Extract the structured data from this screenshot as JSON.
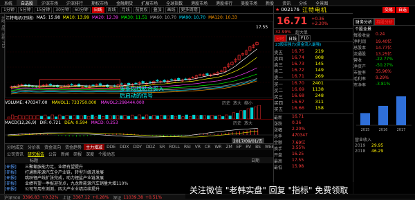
{
  "topmenu": [
    "系统",
    "自选股",
    "沪深市场",
    "沪深排行",
    "期权市场",
    "金融期货",
    "扩展市场",
    "全球指数",
    "港股市场",
    "港股排行",
    "美股市场",
    "新股",
    "资讯",
    "分析",
    "全景图"
  ],
  "toolbar": {
    "periods": [
      "1分钟",
      "5分钟",
      "15分钟",
      "30分钟",
      "60分钟",
      "日线",
      "周线",
      "月线"
    ],
    "active": "日线",
    "options": [
      "前复权",
      "叠加",
      "画线",
      "更多周期"
    ],
    "sel": "更多周期"
  },
  "ma_header": {
    "name": "江特电机(日线)",
    "items": [
      {
        "label": "MA5: 15.98",
        "color": "#ffffff"
      },
      {
        "label": "MA10: 13.99",
        "color": "#ffff00"
      },
      {
        "label": "MA20: 12.39",
        "color": "#ff40ff"
      },
      {
        "label": "MA30: 11.51",
        "color": "#00ff00"
      },
      {
        "label": "MA60: 10.70",
        "color": "#aaaaaa"
      },
      {
        "label": "MA90: 10.70",
        "color": "#00e0ff"
      },
      {
        "label": "MA120: 10.33",
        "color": "#ff9900"
      }
    ]
  },
  "sidebar": [
    "分时",
    "K线",
    "分析",
    "F10"
  ],
  "chart_meta": {
    "price_high": "17.55",
    "annotation_line1": "多条均线粘合买入",
    "annotation_line2": "后启动的信号"
  },
  "vol_header": {
    "label": "VOLUME: 470347.00",
    "ma5": "MAVOL1: 733750.000",
    "ma10": "MAVOL2:298444.000",
    "btns": [
      "历史",
      "放大",
      "缩小"
    ]
  },
  "macd_header": {
    "label": "MACD(12,26,9)",
    "dif": "DIF: 0.721",
    "dea": "DEA: 0.594",
    "macd": "MACD: 0.253",
    "btns": [
      "历史",
      "放大"
    ]
  },
  "bottom_tabs": [
    "分时成交",
    "分价表",
    "资金流向",
    "资金趋势",
    "主力增减",
    "DDE",
    "DDX",
    "DDY",
    "DDZ",
    "SR",
    "ROLL",
    "RSI",
    "VR",
    "CR",
    "WR",
    "ZM",
    "EP",
    "RV",
    "BS",
    "WEB"
  ],
  "bottom_tab_sel": "主力增减",
  "sub_tabs": [
    "公司资讯",
    "研究报告",
    "公告",
    "新闻",
    "研报",
    "深度",
    "个股动态"
  ],
  "sub_tab_sel": "研究报告",
  "news_header": {
    "title": "标题",
    "date": "日期"
  },
  "news": [
    {
      "tag": "[研报]",
      "title": "三聚氰胺能力足，业绩有望提升"
    },
    {
      "tag": "[研报]",
      "title": "打通新能源汽车全产业链，转型升级进发展"
    },
    {
      "tag": "[研报]",
      "title": "跳跃锂产线扩张完成，助力锂盐产业链发展"
    },
    {
      "tag": "[研报]",
      "title": "业绩有望一季报迎拐点，九龙新能源汽车销量大增110%"
    },
    {
      "tag": "[研报]",
      "title": "公司专用车测测，四大产业业绩持续提升"
    }
  ],
  "date_label": "2017/09/01/五",
  "status": {
    "items": [
      "沪深300",
      "上证",
      "深证"
    ],
    "values": [
      "3396.83",
      "3367.12",
      "11039.38"
    ],
    "changes": [
      "+0.32%",
      "+0.28%",
      "+0.51%"
    ]
  },
  "right": {
    "code": "002176",
    "name": "江特电机",
    "buttons": [
      "交易",
      "自选"
    ],
    "price": "16.71",
    "change": "+0.36",
    "pct": "+2.20%",
    "change2": "32.99%",
    "vol_label": "超大单",
    "tabs": [
      "分时",
      "日线",
      "F10"
    ],
    "link": "23股买强力(资金流入最强)",
    "sells": [
      {
        "l": "卖五",
        "p": "16.75",
        "v": "219"
      },
      {
        "l": "卖四",
        "p": "16.74",
        "v": "908"
      },
      {
        "l": "卖三",
        "p": "16.73",
        "v": "145"
      },
      {
        "l": "卖二",
        "p": "16.72",
        "v": "149"
      },
      {
        "l": "卖一",
        "p": "16.71",
        "v": "269"
      }
    ],
    "buys": [
      {
        "l": "买一",
        "p": "16.70",
        "v": "2401"
      },
      {
        "l": "买二",
        "p": "16.69",
        "v": "1138"
      },
      {
        "l": "买三",
        "p": "16.68",
        "v": "248"
      },
      {
        "l": "买四",
        "p": "16.67",
        "v": "311"
      },
      {
        "l": "买五",
        "p": "16.66",
        "v": "158"
      }
    ],
    "stats": [
      {
        "k": "最新",
        "v": "16.71"
      },
      {
        "k": "涨跌",
        "v": "0.36"
      },
      {
        "k": "涨幅",
        "v": "2.20%"
      },
      {
        "k": "总手",
        "v": "470347"
      },
      {
        "k": "金额",
        "v": "7.69亿"
      },
      {
        "k": "换手",
        "v": "3.55%"
      },
      {
        "k": "开盘",
        "v": "16.25"
      },
      {
        "k": "最高",
        "v": "17.55"
      },
      {
        "k": "最低",
        "v": "15.98"
      }
    ]
  },
  "right2": {
    "tabs": [
      "财务分析",
      "持股分析"
    ],
    "header": "个股全景",
    "rows": [
      {
        "k": "每股收益",
        "v": "0.24"
      },
      {
        "k": "净利润",
        "v": "19.40亿"
      },
      {
        "k": "总股本",
        "v": "14.77亿"
      },
      {
        "k": "流通股",
        "v": "13.25亿"
      },
      {
        "k": "营收",
        "v": "-22.77%"
      },
      {
        "k": "净资产",
        "v": "-50.27%"
      },
      {
        "k": "市盈率",
        "v": "35.96%"
      },
      {
        "k": "毛利率",
        "v": "9.29%"
      },
      {
        "k": "市净率",
        "v": "-3.81%"
      }
    ],
    "bar_years": [
      "2015",
      "2016",
      "2017"
    ],
    "bar_values": [
      3.2,
      5.1,
      7.6
    ],
    "bottom": {
      "label": "营业收入",
      "years": [
        "2019",
        "2018"
      ],
      "values": [
        "29.95",
        "46.29"
      ]
    }
  },
  "watermark": "关注微信 \"老韩实盘\" 回复 \"指标\" 免费领取"
}
